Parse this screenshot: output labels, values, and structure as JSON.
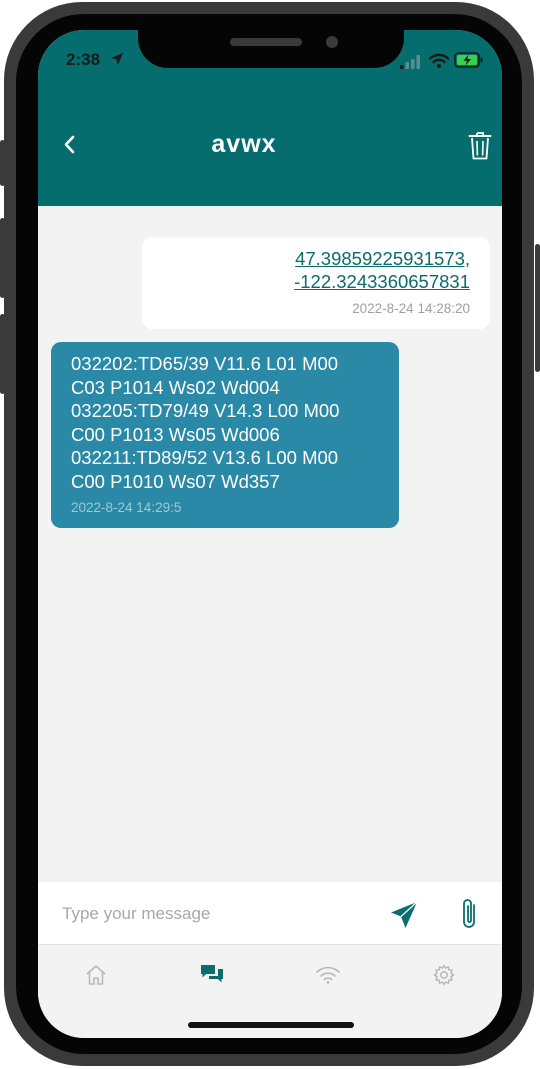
{
  "status_bar": {
    "time": "2:38"
  },
  "header": {
    "title": "avwx"
  },
  "messages": {
    "outgoing": {
      "lines": [
        "47.39859225931573,",
        "-122.3243360657831"
      ],
      "timestamp": "2022-8-24 14:28:20"
    },
    "incoming": {
      "lines": [
        "032202:TD65/39 V11.6 L01 M00",
        "C03 P1014 Ws02 Wd004",
        "032205:TD79/49 V14.3 L00 M00",
        "C00 P1013 Ws05 Wd006",
        "032211:TD89/52 V13.6 L00 M00",
        "C00 P1010 Ws07 Wd357"
      ],
      "timestamp": "2022-8-24 14:29:5"
    }
  },
  "composer": {
    "placeholder": "Type your message",
    "value": ""
  },
  "tabs": [
    {
      "icon": "home-icon",
      "active": false
    },
    {
      "icon": "chat-icon",
      "active": true
    },
    {
      "icon": "wifi-icon",
      "active": false
    },
    {
      "icon": "gear-icon",
      "active": false
    }
  ],
  "colors": {
    "header": "#056d6d",
    "incoming_bubble": "#2a89a7",
    "outgoing_bubble": "#ffffff",
    "link": "#0c6b6b",
    "active_tab": "#0a6e6e",
    "inactive_tab": "#b8b8b8"
  }
}
